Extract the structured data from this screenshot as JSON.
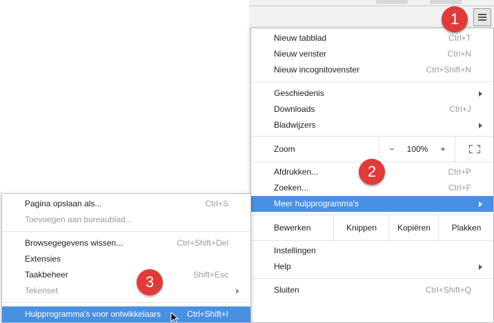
{
  "badges": [
    "1",
    "2",
    "3"
  ],
  "main_menu": {
    "new_tab": {
      "label": "Nieuw tabblad",
      "shortcut": "Ctrl+T"
    },
    "new_window": {
      "label": "Nieuw venster",
      "shortcut": "Ctrl+N"
    },
    "new_incognito": {
      "label": "Nieuw incognitovenster",
      "shortcut": "Ctrl+Shift+N"
    },
    "history": {
      "label": "Geschiedenis"
    },
    "downloads": {
      "label": "Downloads",
      "shortcut": "Ctrl+J"
    },
    "bookmarks": {
      "label": "Bladwijzers"
    },
    "zoom": {
      "label": "Zoom",
      "minus": "−",
      "value": "100%",
      "plus": "+"
    },
    "print": {
      "label": "Afdrukken...",
      "shortcut": "Ctrl+P"
    },
    "find": {
      "label": "Zoeken...",
      "shortcut": "Ctrl+F"
    },
    "more_tools": {
      "label": "Meer hulpprogramma's"
    },
    "edit": {
      "label": "Bewerken",
      "cut": "Knippen",
      "copy": "Kopiëren",
      "paste": "Plakken"
    },
    "settings": {
      "label": "Instellingen"
    },
    "help": {
      "label": "Help"
    },
    "exit": {
      "label": "Sluiten",
      "shortcut": "Ctrl+Shift+Q"
    }
  },
  "sub_menu": {
    "save_page": {
      "label": "Pagina opslaan als...",
      "shortcut": "Ctrl+S"
    },
    "add_desktop": {
      "label": "Toevoegen aan bureaublad..."
    },
    "clear_data": {
      "label": "Browsegegevens wissen...",
      "shortcut": "Ctrl+Shift+Del"
    },
    "extensions": {
      "label": "Extensies"
    },
    "task_manager": {
      "label": "Taakbeheer",
      "shortcut": "Shift+Esc"
    },
    "encoding": {
      "label": "Tekenset"
    },
    "dev_tools": {
      "label": "Hulpprogramma's voor ontwikkelaars",
      "shortcut": "Ctrl+Shift+I"
    }
  },
  "colors": {
    "highlight": "#4a90e2",
    "badge": "#e03a3a"
  }
}
